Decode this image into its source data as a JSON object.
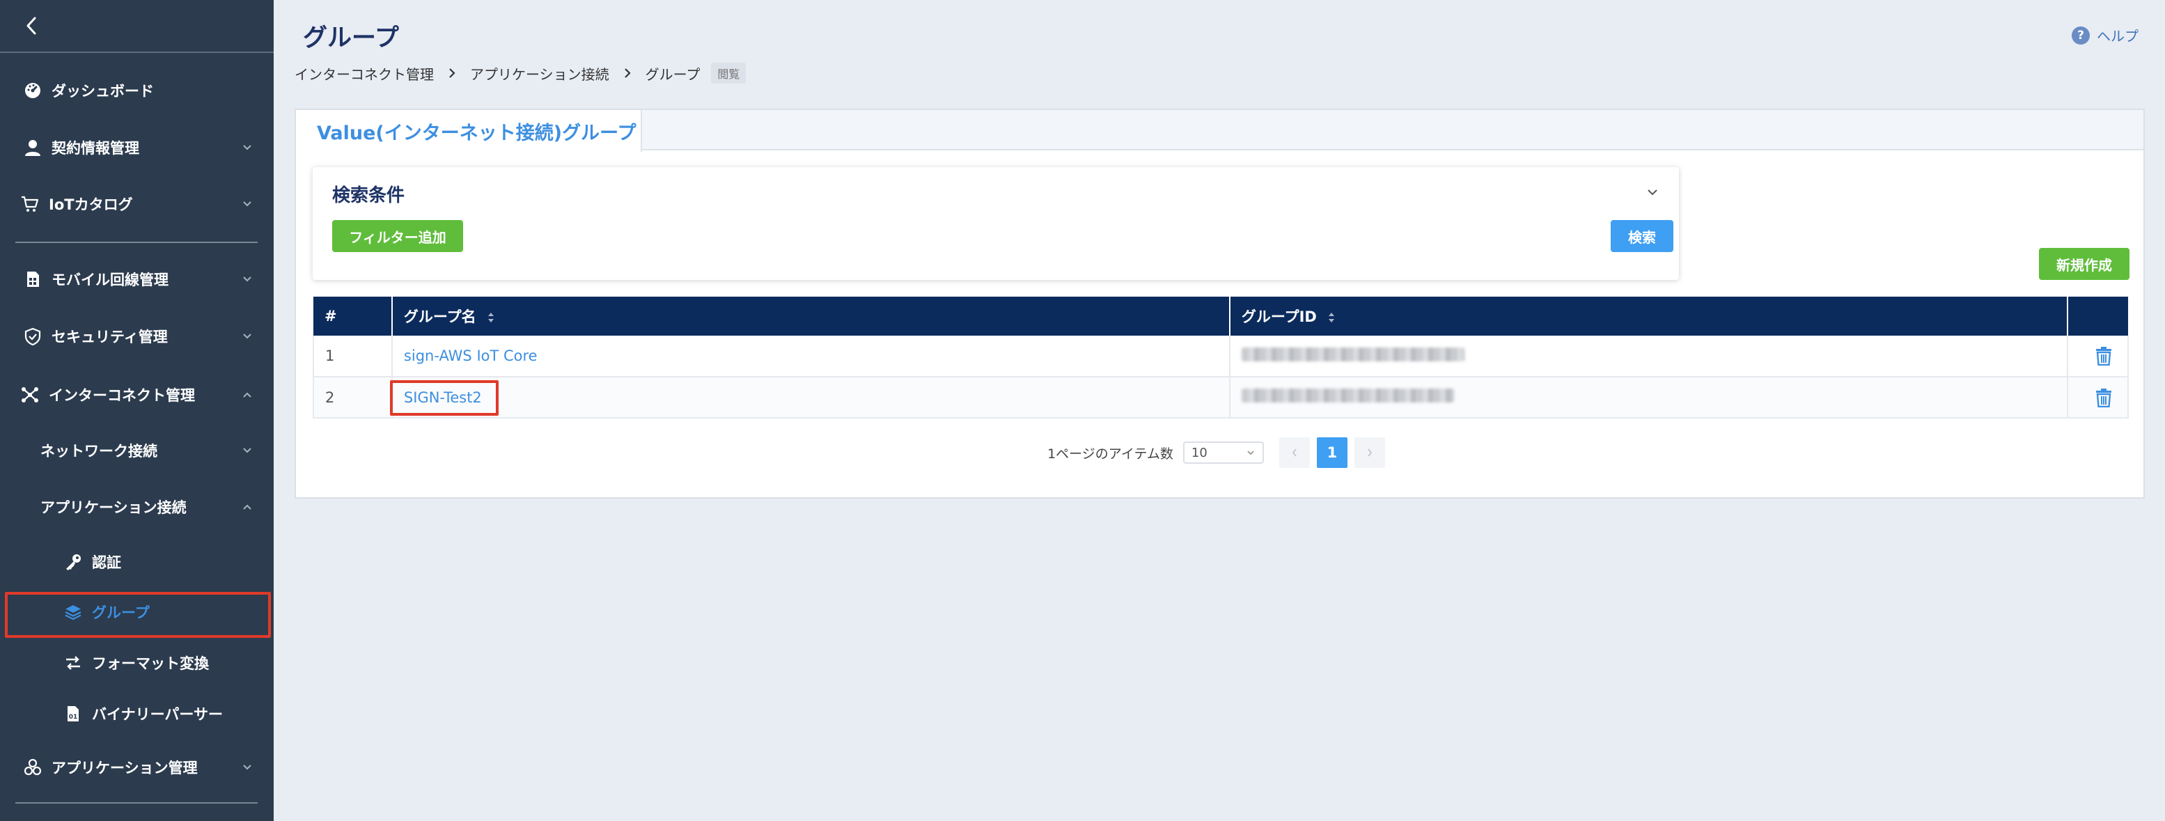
{
  "sidebar": {
    "items": [
      {
        "label": "ダッシュボード",
        "icon": "dashboard-icon"
      },
      {
        "label": "契約情報管理",
        "icon": "user-icon"
      },
      {
        "label": "IoTカタログ",
        "icon": "cart-icon"
      },
      {
        "label": "モバイル回線管理",
        "icon": "sim-icon"
      },
      {
        "label": "セキュリティ管理",
        "icon": "shield-icon"
      },
      {
        "label": "インターコネクト管理",
        "icon": "interconnect-icon"
      },
      {
        "label": "ネットワーク接続"
      },
      {
        "label": "アプリケーション接続"
      },
      {
        "label": "認証",
        "icon": "key-icon"
      },
      {
        "label": "グループ",
        "icon": "layers-icon"
      },
      {
        "label": "フォーマット変換",
        "icon": "format-convert-icon"
      },
      {
        "label": "バイナリーパーサー",
        "icon": "binary-file-icon"
      },
      {
        "label": "アプリケーション管理",
        "icon": "apps-icon"
      }
    ]
  },
  "header": {
    "title": "グループ",
    "help_label": "ヘルプ"
  },
  "breadcrumb": {
    "items": [
      "インターコネクト管理",
      "アプリケーション接続",
      "グループ"
    ],
    "badge": "閲覧"
  },
  "tab": {
    "label": "Value(インターネット接続)グループ"
  },
  "search": {
    "title": "検索条件",
    "filter_button": "フィルター追加",
    "search_button": "検索"
  },
  "create_button": "新規作成",
  "table": {
    "headers": [
      "#",
      "グループ名",
      "グループID",
      ""
    ],
    "rows": [
      {
        "index": "1",
        "name": "sign-AWS IoT Core"
      },
      {
        "index": "2",
        "name": "SIGN-Test2"
      }
    ]
  },
  "pagination": {
    "label": "1ページのアイテム数",
    "page_size": "10",
    "current_page": "1"
  },
  "colors": {
    "sidebar_bg": "#2c3b4e",
    "accent_blue": "#3d8fe0",
    "table_header": "#0c2b5d",
    "green_button": "#5fbd3b",
    "highlight_red": "#e03a2a"
  }
}
